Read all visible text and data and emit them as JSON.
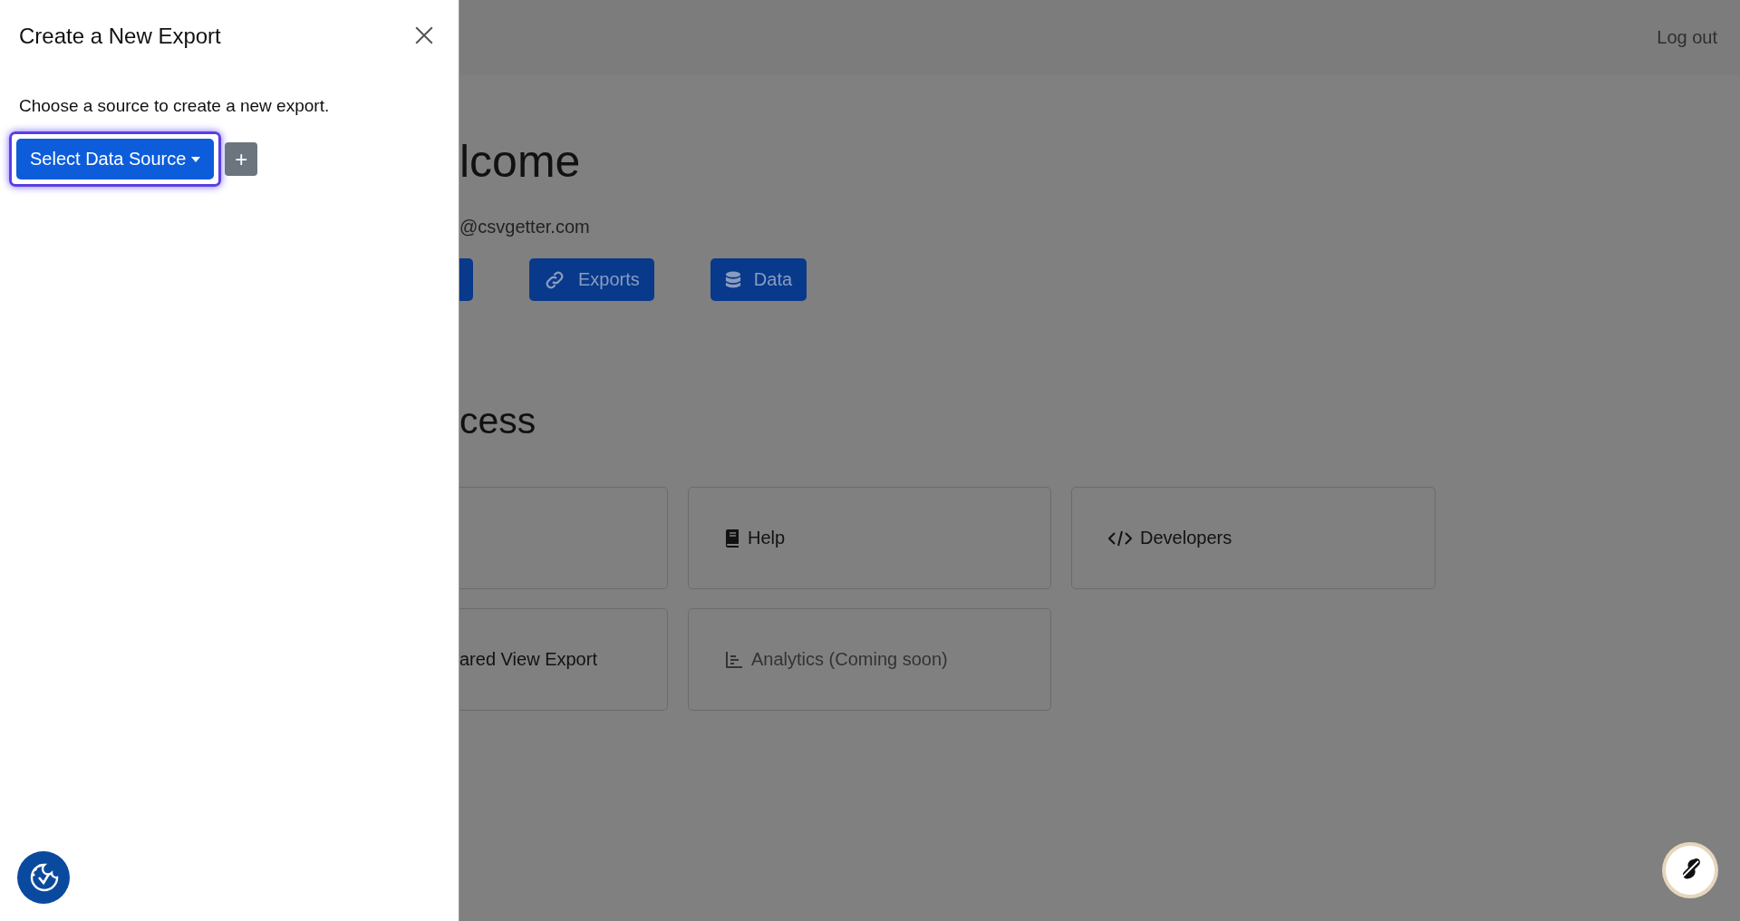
{
  "panel": {
    "title": "Create a New Export",
    "description": "Choose a source to create a new export.",
    "select_button": "Select Data Source",
    "add_button": "+"
  },
  "header": {
    "logout": "Log out"
  },
  "main": {
    "heading": "lcome",
    "email": "@csvgetter.com",
    "buttons": [
      {
        "label": "Exports"
      },
      {
        "label": "Data"
      }
    ],
    "section_heading": "cess",
    "cards": [
      {
        "kind": "blank"
      },
      {
        "kind": "link",
        "label": "Help",
        "disabled": false
      },
      {
        "kind": "link",
        "label": "Developers",
        "disabled": false
      },
      {
        "kind": "link",
        "label": "ared View Export",
        "disabled": false
      },
      {
        "kind": "link",
        "label": "Analytics (Coming soon)",
        "disabled": true
      }
    ]
  }
}
